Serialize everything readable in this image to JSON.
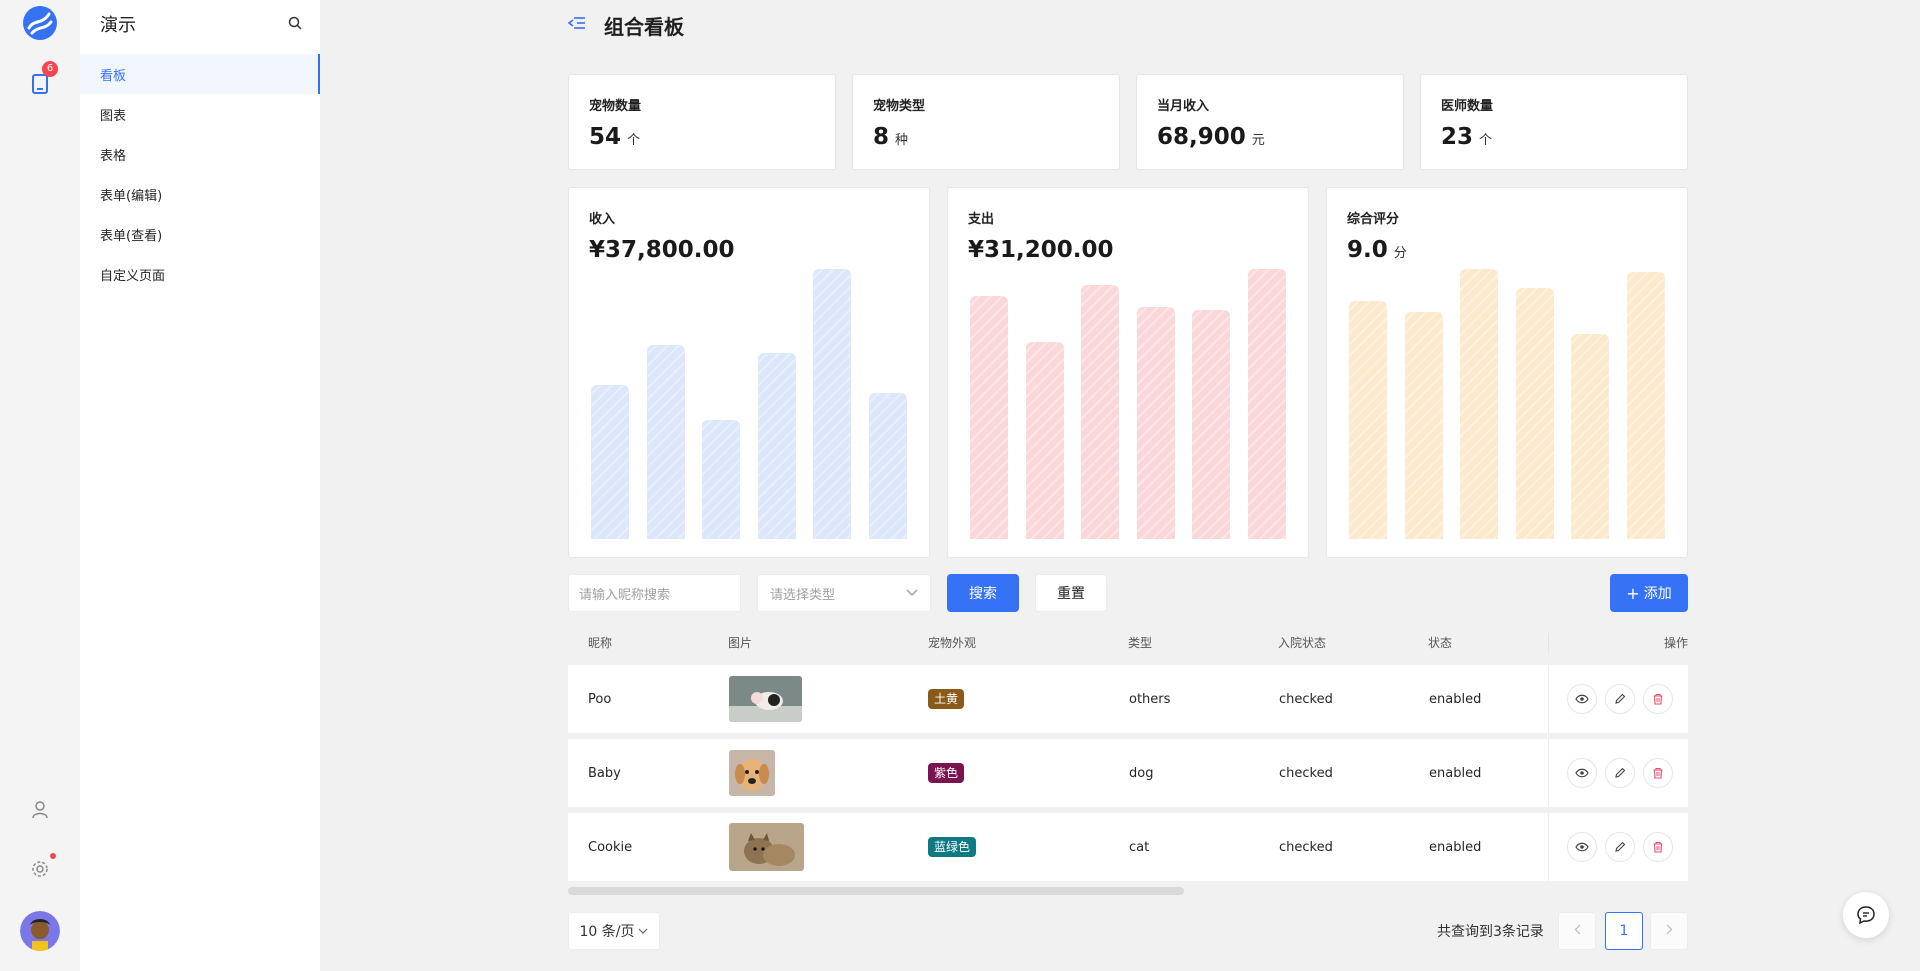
{
  "app": {
    "name": "演示",
    "brand_color": "#3471f3",
    "notification_count": "6"
  },
  "menu": {
    "items": [
      {
        "label": "看板",
        "active": true
      },
      {
        "label": "图表"
      },
      {
        "label": "表格"
      },
      {
        "label": "表单(编辑)"
      },
      {
        "label": "表单(查看)"
      },
      {
        "label": "自定义页面"
      }
    ]
  },
  "page": {
    "title": "组合看板"
  },
  "stats": [
    {
      "label": "宠物数量",
      "value": "54",
      "unit": "个"
    },
    {
      "label": "宠物类型",
      "value": "8",
      "unit": "种"
    },
    {
      "label": "当月收入",
      "value": "68,900",
      "unit": "元"
    },
    {
      "label": "医师数量",
      "value": "23",
      "unit": "个"
    }
  ],
  "chart_data": [
    {
      "type": "bar",
      "title": "收入",
      "value_text": "¥37,800.00",
      "unit": "",
      "color": "#dce7fb",
      "values": [
        57,
        72,
        44,
        69,
        100,
        54
      ]
    },
    {
      "type": "bar",
      "title": "支出",
      "value_text": "¥31,200.00",
      "unit": "",
      "color": "#fbd7d9",
      "values": [
        90,
        73,
        94,
        86,
        85,
        100
      ]
    },
    {
      "type": "bar",
      "title": "综合评分",
      "value_text": "9.0",
      "unit": "分",
      "color": "#fde9cc",
      "values": [
        88,
        84,
        100,
        93,
        76,
        99
      ]
    }
  ],
  "filters": {
    "search_placeholder": "请输入昵称搜索",
    "type_placeholder": "请选择类型",
    "search_label": "搜索",
    "reset_label": "重置",
    "add_label": "添加"
  },
  "table": {
    "columns": [
      "昵称",
      "图片",
      "宠物外观",
      "类型",
      "入院状态",
      "状态",
      "操作"
    ],
    "rows": [
      {
        "name": "Poo",
        "appearance": "土黄",
        "appearance_color": "#8a5a19",
        "type": "others",
        "admission": "checked",
        "status": "enabled",
        "image": "pig-photo"
      },
      {
        "name": "Baby",
        "appearance": "紫色",
        "appearance_color": "#7a1450",
        "type": "dog",
        "admission": "checked",
        "status": "enabled",
        "image": "dog-photo"
      },
      {
        "name": "Cookie",
        "appearance": "蓝绿色",
        "appearance_color": "#107a84",
        "type": "cat",
        "admission": "checked",
        "status": "enabled",
        "image": "cat-photo"
      }
    ]
  },
  "pagination": {
    "page_size": "10 条/页",
    "total_text": "共查询到3条记录",
    "current": "1"
  }
}
